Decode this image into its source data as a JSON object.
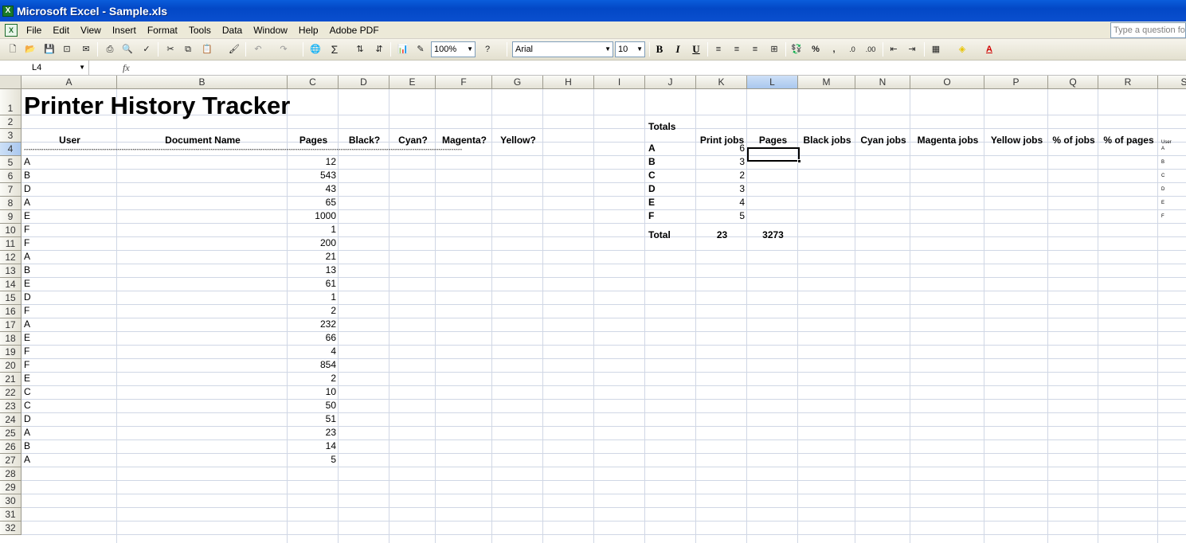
{
  "window": {
    "title": "Microsoft Excel - Sample.xls"
  },
  "menu": {
    "items": [
      "File",
      "Edit",
      "View",
      "Insert",
      "Format",
      "Tools",
      "Data",
      "Window",
      "Help",
      "Adobe PDF"
    ],
    "ask_placeholder": "Type a question for help"
  },
  "toolbar": {
    "zoom": "100%",
    "font": "Arial",
    "font_size": "10",
    "bold": "B",
    "italic": "I",
    "underline": "U",
    "percent": "%",
    "comma": ","
  },
  "formula_bar": {
    "name_box": "L4",
    "fx": "fx",
    "value": ""
  },
  "columns": [
    "A",
    "B",
    "C",
    "D",
    "E",
    "F",
    "G",
    "H",
    "I",
    "J",
    "K",
    "L",
    "M",
    "N",
    "O",
    "P",
    "Q",
    "R",
    "S"
  ],
  "selected_column": "L",
  "rows": [
    "1",
    "2",
    "3",
    "4",
    "5",
    "6",
    "7",
    "8",
    "9",
    "10",
    "11",
    "12",
    "13",
    "14",
    "15",
    "16",
    "17",
    "18",
    "19",
    "20",
    "21",
    "22",
    "23",
    "24",
    "25",
    "26",
    "27",
    "28",
    "29",
    "30",
    "31",
    "32"
  ],
  "selected_row": "4",
  "sheet": {
    "title": "Printer History Tracker",
    "headers": [
      "User",
      "Document Name",
      "Pages",
      "Black?",
      "Cyan?",
      "Magenta?",
      "Yellow?"
    ],
    "separator": "**********************************************************************************************************************************************************************************************************",
    "entries": [
      {
        "user": "A",
        "pages": "12"
      },
      {
        "user": "B",
        "pages": "543"
      },
      {
        "user": "D",
        "pages": "43"
      },
      {
        "user": "A",
        "pages": "65"
      },
      {
        "user": "E",
        "pages": "1000"
      },
      {
        "user": "F",
        "pages": "1"
      },
      {
        "user": "F",
        "pages": "200"
      },
      {
        "user": "A",
        "pages": "21"
      },
      {
        "user": "B",
        "pages": "13"
      },
      {
        "user": "E",
        "pages": "61"
      },
      {
        "user": "D",
        "pages": "1"
      },
      {
        "user": "F",
        "pages": "2"
      },
      {
        "user": "A",
        "pages": "232"
      },
      {
        "user": "E",
        "pages": "66"
      },
      {
        "user": "F",
        "pages": "4"
      },
      {
        "user": "F",
        "pages": "854"
      },
      {
        "user": "E",
        "pages": "2"
      },
      {
        "user": "C",
        "pages": "10"
      },
      {
        "user": "C",
        "pages": "50"
      },
      {
        "user": "D",
        "pages": "51"
      },
      {
        "user": "A",
        "pages": "23"
      },
      {
        "user": "B",
        "pages": "14"
      },
      {
        "user": "A",
        "pages": "5"
      }
    ]
  },
  "totals": {
    "label": "Totals",
    "headers": [
      "Print jobs",
      "Pages",
      "Black jobs",
      "Cyan jobs",
      "Magenta jobs",
      "Yellow jobs",
      "% of jobs",
      "% of pages"
    ],
    "col_s_header": "User",
    "rows": [
      {
        "user": "A",
        "jobs": "6",
        "tiny": "A"
      },
      {
        "user": "B",
        "jobs": "3",
        "tiny": "B"
      },
      {
        "user": "C",
        "jobs": "2",
        "tiny": "C"
      },
      {
        "user": "D",
        "jobs": "3",
        "tiny": "D"
      },
      {
        "user": "E",
        "jobs": "4",
        "tiny": "E"
      },
      {
        "user": "F",
        "jobs": "5",
        "tiny": "F"
      }
    ],
    "total_label": "Total",
    "total_jobs": "23",
    "total_pages": "3273"
  }
}
